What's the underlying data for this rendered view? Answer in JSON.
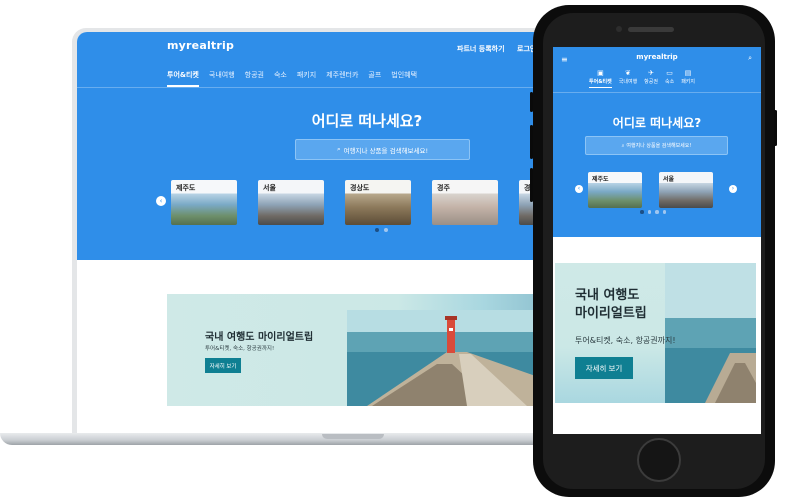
{
  "laptop": {
    "logo": "myrealtrip",
    "header_links": {
      "partner": "파트너 등록하기",
      "login": "로그인"
    },
    "nav": [
      "투어&티켓",
      "국내여행",
      "항공권",
      "숙소",
      "패키지",
      "제주렌터카",
      "골프",
      "법인혜택"
    ],
    "hero_title": "어디로 떠나세요?",
    "search_placeholder": "여행지나 상품을 검색해보세요!",
    "cities": [
      "제주도",
      "서울",
      "경상도",
      "경주",
      "경기"
    ],
    "carousel_dots": 2,
    "banner": {
      "title": "국내 여행도 마이리얼트립",
      "subtitle": "투어&티켓, 숙소, 항공권까지!",
      "button": "자세히 보기"
    }
  },
  "phone": {
    "logo": "myrealtrip",
    "nav": [
      {
        "label": "투어&티켓",
        "icon": "ticket-icon"
      },
      {
        "label": "국내여행",
        "icon": "leaf-icon"
      },
      {
        "label": "항공권",
        "icon": "airplane-icon"
      },
      {
        "label": "숙소",
        "icon": "bed-icon"
      },
      {
        "label": "패키지",
        "icon": "bag-icon"
      }
    ],
    "hero_title": "어디로 떠나세요?",
    "search_placeholder": "여행지나 상품을 검색해보세요!",
    "cities": [
      "제주도",
      "서울"
    ],
    "carousel_dots": 4,
    "banner": {
      "title_line1": "국내 여행도",
      "title_line2": "마이리얼트립",
      "subtitle": "투어&티켓, 숙소, 항공권까지!",
      "button": "자세히 보기"
    }
  },
  "colors": {
    "brand_blue": "#2f8ee9",
    "banner_button": "#0f7f92",
    "banner_bg": "#cfe9e7"
  }
}
